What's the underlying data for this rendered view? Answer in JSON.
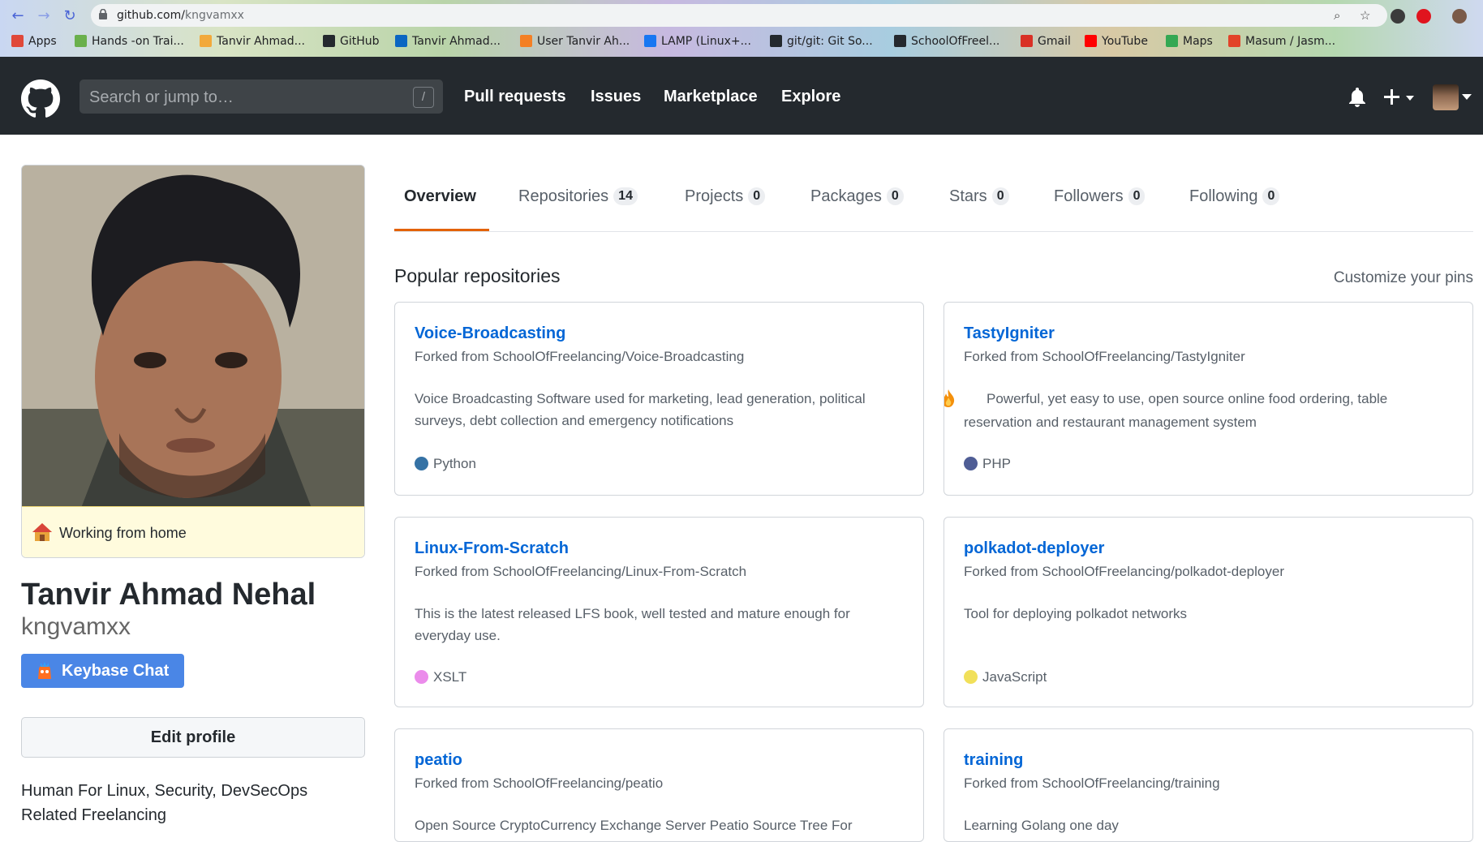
{
  "browser": {
    "url_host": "github.com/",
    "url_path": "kngvamxx",
    "bookmarks": [
      {
        "label": "Apps",
        "color": "#e0483a"
      },
      {
        "label": "Hands -on Trai...",
        "color": "#6ab04c"
      },
      {
        "label": "Tanvir Ahmad...",
        "color": "#f2a93b"
      },
      {
        "label": "GitHub",
        "color": "#24292e"
      },
      {
        "label": "Tanvir Ahmad...",
        "color": "#0a66c2"
      },
      {
        "label": "User Tanvir Ah...",
        "color": "#f48024"
      },
      {
        "label": "LAMP (Linux+...",
        "color": "#1877f2"
      },
      {
        "label": "git/git: Git So...",
        "color": "#24292e"
      },
      {
        "label": "SchoolOfFreel...",
        "color": "#24292e"
      },
      {
        "label": "Gmail",
        "color": "#d93025"
      },
      {
        "label": "YouTube",
        "color": "#ff0000"
      },
      {
        "label": "Maps",
        "color": "#34a853"
      },
      {
        "label": "Masum / Jasm...",
        "color": "#e24329"
      }
    ]
  },
  "header": {
    "search_placeholder": "Search or jump to…",
    "search_shortcut": "/",
    "nav": [
      "Pull requests",
      "Issues",
      "Marketplace",
      "Explore"
    ]
  },
  "profile": {
    "status": "Working from home",
    "full_name": "Tanvir Ahmad Nehal",
    "username": "kngvamxx",
    "keybase_label": "Keybase Chat",
    "edit_label": "Edit profile",
    "bio": "Human For Linux, Security, DevSecOps Related Freelancing"
  },
  "tabs": [
    {
      "label": "Overview",
      "count": null
    },
    {
      "label": "Repositories",
      "count": "14"
    },
    {
      "label": "Projects",
      "count": "0"
    },
    {
      "label": "Packages",
      "count": "0"
    },
    {
      "label": "Stars",
      "count": "0"
    },
    {
      "label": "Followers",
      "count": "0"
    },
    {
      "label": "Following",
      "count": "0"
    }
  ],
  "popular": {
    "title": "Popular repositories",
    "customize": "Customize your pins",
    "repos": [
      {
        "name": "Voice-Broadcasting",
        "fork": "Forked from SchoolOfFreelancing/Voice-Broadcasting",
        "desc": "Voice Broadcasting Software used for marketing, lead generation, political surveys, debt collection and emergency notifications",
        "lang": "Python",
        "lang_color": "#3572a5"
      },
      {
        "name": "TastyIgniter",
        "fork": "Forked from SchoolOfFreelancing/TastyIgniter",
        "desc": "Powerful, yet easy to use, open source online food ordering, table reservation and restaurant management system",
        "lang": "PHP",
        "lang_color": "#4f5d95"
      },
      {
        "name": "Linux-From-Scratch",
        "fork": "Forked from SchoolOfFreelancing/Linux-From-Scratch",
        "desc": "This is the latest released LFS book, well tested and mature enough for everyday use.",
        "lang": "XSLT",
        "lang_color": "#eb8ceb"
      },
      {
        "name": "polkadot-deployer",
        "fork": "Forked from SchoolOfFreelancing/polkadot-deployer",
        "desc": "Tool for deploying polkadot networks",
        "lang": "JavaScript",
        "lang_color": "#f1e05a"
      },
      {
        "name": "peatio",
        "fork": "Forked from SchoolOfFreelancing/peatio",
        "desc": "Open Source CryptoCurrency Exchange Server Peatio Source Tree For",
        "lang": "",
        "lang_color": ""
      },
      {
        "name": "training",
        "fork": "Forked from SchoolOfFreelancing/training",
        "desc": "Learning Golang one day",
        "lang": "",
        "lang_color": ""
      }
    ]
  }
}
